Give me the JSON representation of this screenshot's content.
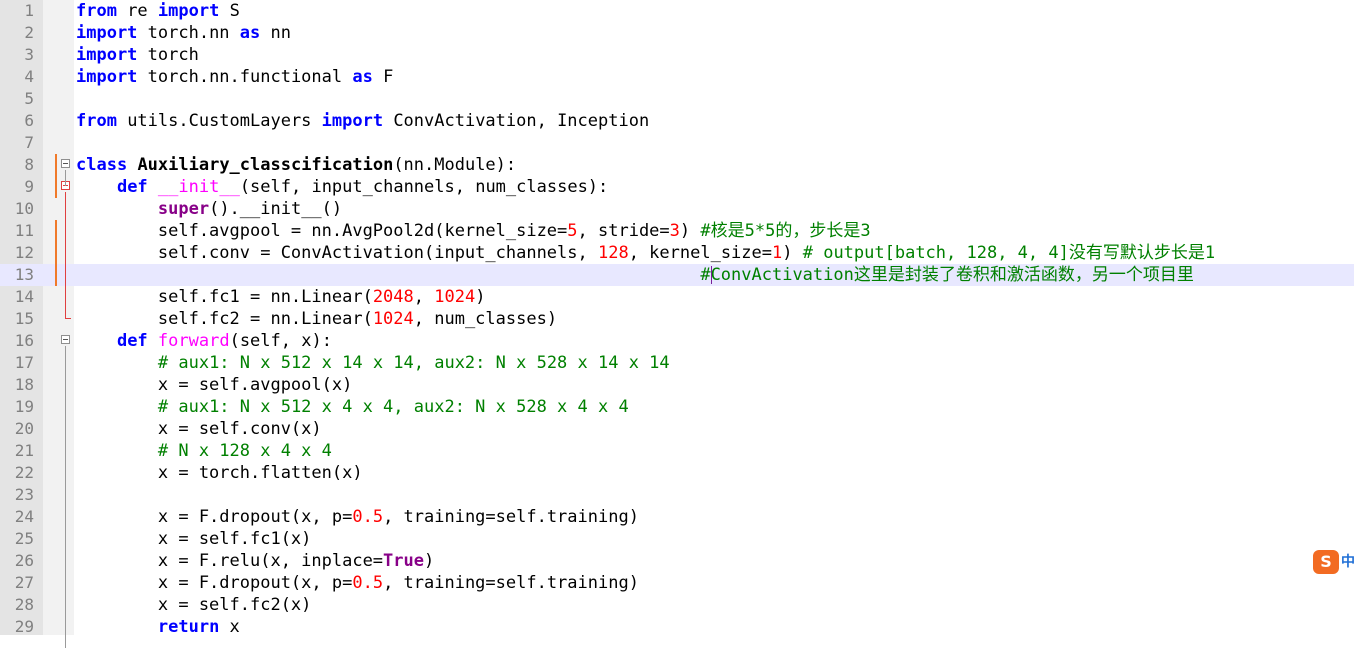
{
  "editor": {
    "lines": [
      {
        "n": "1",
        "tokens": [
          {
            "t": "from",
            "c": "kw"
          },
          {
            "t": " re ",
            "c": ""
          },
          {
            "t": "import",
            "c": "kw"
          },
          {
            "t": " S",
            "c": ""
          }
        ]
      },
      {
        "n": "2",
        "tokens": [
          {
            "t": "import",
            "c": "kw"
          },
          {
            "t": " torch.nn ",
            "c": ""
          },
          {
            "t": "as",
            "c": "kw"
          },
          {
            "t": " nn",
            "c": ""
          }
        ]
      },
      {
        "n": "3",
        "tokens": [
          {
            "t": "import",
            "c": "kw"
          },
          {
            "t": " torch",
            "c": ""
          }
        ]
      },
      {
        "n": "4",
        "tokens": [
          {
            "t": "import",
            "c": "kw"
          },
          {
            "t": " torch.nn.functional ",
            "c": ""
          },
          {
            "t": "as",
            "c": "kw"
          },
          {
            "t": " F",
            "c": ""
          }
        ]
      },
      {
        "n": "5",
        "tokens": []
      },
      {
        "n": "6",
        "tokens": [
          {
            "t": "from",
            "c": "kw"
          },
          {
            "t": " utils.CustomLayers ",
            "c": ""
          },
          {
            "t": "import",
            "c": "kw"
          },
          {
            "t": " ConvActivation, Inception",
            "c": ""
          }
        ]
      },
      {
        "n": "7",
        "tokens": []
      },
      {
        "n": "8",
        "tokens": [
          {
            "t": "class",
            "c": "kw"
          },
          {
            "t": " ",
            "c": ""
          },
          {
            "t": "Auxiliary_classcification",
            "c": "cls"
          },
          {
            "t": "(nn.Module):",
            "c": ""
          }
        ]
      },
      {
        "n": "9",
        "tokens": [
          {
            "t": "    ",
            "c": ""
          },
          {
            "t": "def",
            "c": "kw"
          },
          {
            "t": " ",
            "c": ""
          },
          {
            "t": "__init__",
            "c": "fn"
          },
          {
            "t": "(self, input_channels, num_classes):",
            "c": ""
          }
        ]
      },
      {
        "n": "10",
        "tokens": [
          {
            "t": "        ",
            "c": ""
          },
          {
            "t": "super",
            "c": "bi"
          },
          {
            "t": "().__init__()",
            "c": ""
          }
        ]
      },
      {
        "n": "11",
        "tokens": [
          {
            "t": "        self.avgpool = nn.AvgPool2d(kernel_size=",
            "c": ""
          },
          {
            "t": "5",
            "c": "num"
          },
          {
            "t": ", stride=",
            "c": ""
          },
          {
            "t": "3",
            "c": "num"
          },
          {
            "t": ") ",
            "c": ""
          },
          {
            "t": "#核是5*5的，步长是3",
            "c": "cm"
          }
        ]
      },
      {
        "n": "12",
        "tokens": [
          {
            "t": "        self.conv = ConvActivation(input_channels, ",
            "c": ""
          },
          {
            "t": "128",
            "c": "num"
          },
          {
            "t": ", kernel_size=",
            "c": ""
          },
          {
            "t": "1",
            "c": "num"
          },
          {
            "t": ") ",
            "c": ""
          },
          {
            "t": "# output[batch, 128, 4, 4]没有写默认步长是1",
            "c": "cm"
          }
        ]
      },
      {
        "n": "13",
        "tokens": [
          {
            "t": "                                                             ",
            "c": ""
          },
          {
            "t": "#ConvActivation这里是封装了卷积和激活函数，另一个项目里",
            "c": "cm"
          }
        ]
      },
      {
        "n": "14",
        "tokens": [
          {
            "t": "        self.fc1 = nn.Linear(",
            "c": ""
          },
          {
            "t": "2048",
            "c": "num"
          },
          {
            "t": ", ",
            "c": ""
          },
          {
            "t": "1024",
            "c": "num"
          },
          {
            "t": ")",
            "c": ""
          }
        ]
      },
      {
        "n": "15",
        "tokens": [
          {
            "t": "        self.fc2 = nn.Linear(",
            "c": ""
          },
          {
            "t": "1024",
            "c": "num"
          },
          {
            "t": ", num_classes)",
            "c": ""
          }
        ]
      },
      {
        "n": "16",
        "tokens": [
          {
            "t": "    ",
            "c": ""
          },
          {
            "t": "def",
            "c": "kw"
          },
          {
            "t": " ",
            "c": ""
          },
          {
            "t": "forward",
            "c": "fn"
          },
          {
            "t": "(self, x):",
            "c": ""
          }
        ]
      },
      {
        "n": "17",
        "tokens": [
          {
            "t": "        ",
            "c": ""
          },
          {
            "t": "# aux1: N x 512 x 14 x 14, aux2: N x 528 x 14 x 14",
            "c": "cm"
          }
        ]
      },
      {
        "n": "18",
        "tokens": [
          {
            "t": "        x = self.avgpool(x)",
            "c": ""
          }
        ]
      },
      {
        "n": "19",
        "tokens": [
          {
            "t": "        ",
            "c": ""
          },
          {
            "t": "# aux1: N x 512 x 4 x 4, aux2: N x 528 x 4 x 4",
            "c": "cm"
          }
        ]
      },
      {
        "n": "20",
        "tokens": [
          {
            "t": "        x = self.conv(x)",
            "c": ""
          }
        ]
      },
      {
        "n": "21",
        "tokens": [
          {
            "t": "        ",
            "c": ""
          },
          {
            "t": "# N x 128 x 4 x 4",
            "c": "cm"
          }
        ]
      },
      {
        "n": "22",
        "tokens": [
          {
            "t": "        x = torch.flatten(x)",
            "c": ""
          }
        ]
      },
      {
        "n": "23",
        "tokens": []
      },
      {
        "n": "24",
        "tokens": [
          {
            "t": "        x = F.dropout(x, p=",
            "c": ""
          },
          {
            "t": "0.5",
            "c": "num"
          },
          {
            "t": ", training=self.training)",
            "c": ""
          }
        ]
      },
      {
        "n": "25",
        "tokens": [
          {
            "t": "        x = self.fc1(x)",
            "c": ""
          }
        ]
      },
      {
        "n": "26",
        "tokens": [
          {
            "t": "        x = F.relu(x, inplace=",
            "c": ""
          },
          {
            "t": "True",
            "c": "bi"
          },
          {
            "t": ")",
            "c": ""
          }
        ]
      },
      {
        "n": "27",
        "tokens": [
          {
            "t": "        x = F.dropout(x, p=",
            "c": ""
          },
          {
            "t": "0.5",
            "c": "num"
          },
          {
            "t": ", training=self.training)",
            "c": ""
          }
        ]
      },
      {
        "n": "28",
        "tokens": [
          {
            "t": "        x = self.fc2(x)",
            "c": ""
          }
        ]
      },
      {
        "n": "29",
        "tokens": [
          {
            "t": "        ",
            "c": ""
          },
          {
            "t": "return",
            "c": "kw"
          },
          {
            "t": " x",
            "c": ""
          }
        ]
      }
    ],
    "current_line": 13,
    "changed_lines": [
      8,
      9,
      11,
      12,
      13
    ],
    "fold_markers": [
      {
        "line": 8,
        "state": "collapsible"
      },
      {
        "line": 9,
        "state": "collapsible-active"
      },
      {
        "line": 16,
        "state": "collapsible"
      }
    ]
  },
  "ime": {
    "icon": "sogou-ime-icon",
    "label": "中",
    "color": "#f26b22"
  },
  "colors": {
    "keyword": "#0000ff",
    "number": "#ff0000",
    "comment": "#008000",
    "function": "#ff00ff",
    "builtin": "#880088",
    "changed_marker": "#f07a2a"
  }
}
